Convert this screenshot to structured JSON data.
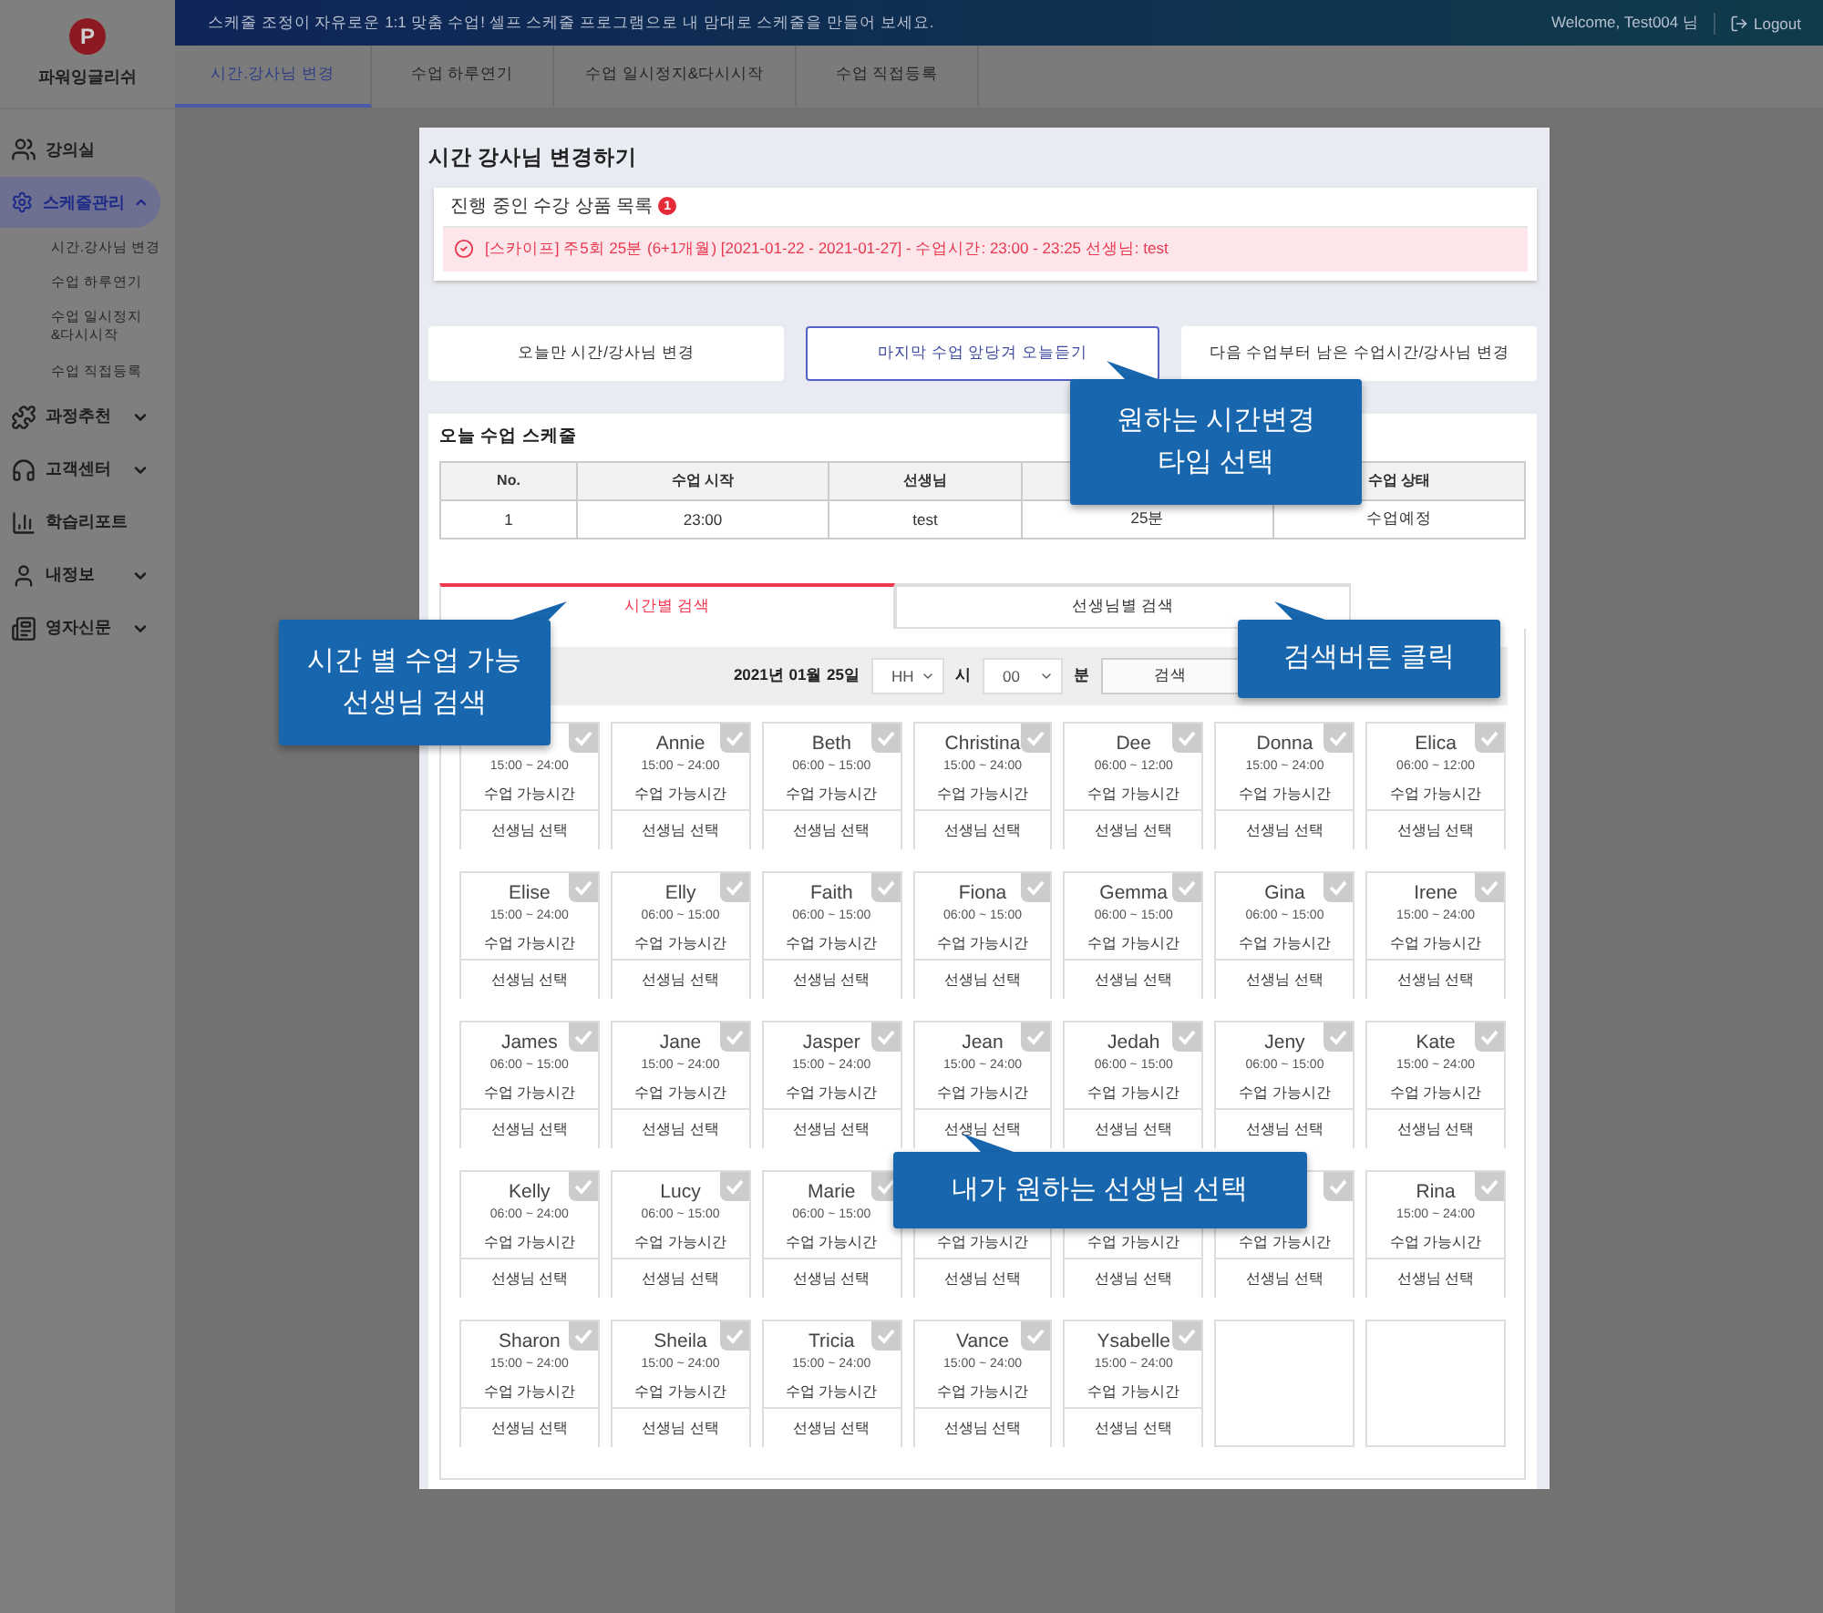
{
  "sidebar": {
    "logo": "P",
    "brand": "파워잉글리쉬",
    "items": [
      {
        "label": "강의실",
        "selected": false
      },
      {
        "label": "스케줄관리",
        "selected": true,
        "expanded": true,
        "children": [
          {
            "lines": [
              "시간.강사님 변경"
            ]
          },
          {
            "lines": [
              "수업 하루연기"
            ]
          },
          {
            "lines": [
              "수업 일시정지",
              "&다시시작"
            ]
          },
          {
            "lines": [
              "수업 직접등록"
            ]
          }
        ]
      },
      {
        "label": "과정추천",
        "selected": false,
        "expanded": false
      },
      {
        "label": "고객센터",
        "selected": false,
        "expanded": false
      },
      {
        "label": "학습리포트",
        "selected": false
      },
      {
        "label": "내정보",
        "selected": false,
        "expanded": false
      },
      {
        "label": "영자신문",
        "selected": false,
        "expanded": false
      }
    ]
  },
  "top_bar": {
    "notice": "스케줄 조정이 자유로운 1:1 맞춤 수업! 셀프 스케줄 프로그램으로 내 맘대로 스케줄을 만들어 보세요.",
    "welcome": "Welcome, Test004 님",
    "logout": "Logout"
  },
  "tabs": [
    {
      "label": "시간.강사님 변경",
      "selected": true
    },
    {
      "label": "수업 하루연기",
      "selected": false
    },
    {
      "label": "수업 일시정지&다시시작",
      "selected": false
    },
    {
      "label": "수업 직접등록",
      "selected": false
    }
  ],
  "modal": {
    "title": "시간 강사님 변경하기",
    "products": {
      "title": "진행 중인 수강 상품 목록",
      "count": "1",
      "items": [
        {
          "text": "[스카이프] 주5회 25분 (6+1개월) [2021-01-22 - 2021-01-27] - 수업시간: 23:00 - 23:25 선생님: test"
        }
      ]
    },
    "options": [
      {
        "label": "오늘만 시간/강사님 변경",
        "selected": false
      },
      {
        "label": "마지막 수업 앞당겨 오늘듣기",
        "selected": true
      },
      {
        "label": "다음 수업부터 남은 수업시간/강사님 변경",
        "selected": false
      }
    ],
    "schedule": {
      "title": "오늘 수업 스케줄",
      "columns": [
        "No.",
        "수업 시작",
        "선생님",
        null,
        "수업 상태"
      ],
      "rows": [
        [
          "1",
          "23:00",
          "test",
          "25분",
          "수업예정"
        ]
      ]
    },
    "search_tabs": [
      {
        "label": "시간별 검색",
        "selected": true
      },
      {
        "label": "선생님별 검색",
        "selected": false
      }
    ],
    "filter": {
      "date": "2021년 01월 25일",
      "hour": "HH",
      "hour_unit": "시",
      "minute": "00",
      "minute_unit": "분",
      "button": "검색"
    },
    "cards": [
      {
        "kind": "teacher",
        "time": "15:00 ~ 24:00",
        "note": "수업 가능시간",
        "action": "선생님 선택"
      },
      {
        "kind": "teacher",
        "name": "Annie",
        "time": "15:00 ~ 24:00",
        "note": "수업 가능시간",
        "action": "선생님 선택"
      },
      {
        "kind": "teacher",
        "name": "Beth",
        "time": "06:00 ~ 15:00",
        "note": "수업 가능시간",
        "action": "선생님 선택"
      },
      {
        "kind": "teacher",
        "name": "Christina",
        "time": "15:00 ~ 24:00",
        "note": "수업 가능시간",
        "action": "선생님 선택"
      },
      {
        "kind": "teacher",
        "name": "Dee",
        "time": "06:00 ~ 12:00",
        "note": "수업 가능시간",
        "action": "선생님 선택"
      },
      {
        "kind": "teacher",
        "name": "Donna",
        "time": "15:00 ~ 24:00",
        "note": "수업 가능시간",
        "action": "선생님 선택"
      },
      {
        "kind": "teacher",
        "name": "Elica",
        "time": "06:00 ~ 12:00",
        "note": "수업 가능시간",
        "action": "선생님 선택"
      },
      {
        "kind": "teacher",
        "name": "Elise",
        "time": "15:00 ~ 24:00",
        "note": "수업 가능시간",
        "action": "선생님 선택"
      },
      {
        "kind": "teacher",
        "name": "Elly",
        "time": "06:00 ~ 15:00",
        "note": "수업 가능시간",
        "action": "선생님 선택"
      },
      {
        "kind": "teacher",
        "name": "Faith",
        "time": "06:00 ~ 15:00",
        "note": "수업 가능시간",
        "action": "선생님 선택"
      },
      {
        "kind": "teacher",
        "name": "Fiona",
        "time": "06:00 ~ 15:00",
        "note": "수업 가능시간",
        "action": "선생님 선택"
      },
      {
        "kind": "teacher",
        "name": "Gemma",
        "time": "06:00 ~ 15:00",
        "note": "수업 가능시간",
        "action": "선생님 선택"
      },
      {
        "kind": "teacher",
        "name": "Gina",
        "time": "06:00 ~ 15:00",
        "note": "수업 가능시간",
        "action": "선생님 선택"
      },
      {
        "kind": "teacher",
        "name": "Irene",
        "time": "15:00 ~ 24:00",
        "note": "수업 가능시간",
        "action": "선생님 선택"
      },
      {
        "kind": "teacher",
        "name": "James",
        "time": "06:00 ~ 15:00",
        "note": "수업 가능시간",
        "action": "선생님 선택"
      },
      {
        "kind": "teacher",
        "name": "Jane",
        "time": "15:00 ~ 24:00",
        "note": "수업 가능시간",
        "action": "선생님 선택"
      },
      {
        "kind": "teacher",
        "name": "Jasper",
        "time": "15:00 ~ 24:00",
        "note": "수업 가능시간",
        "action": "선생님 선택"
      },
      {
        "kind": "teacher",
        "name": "Jean",
        "time": "15:00 ~ 24:00",
        "note": "수업 가능시간",
        "action": "선생님 선택"
      },
      {
        "kind": "teacher",
        "name": "Jedah",
        "time": "06:00 ~ 15:00",
        "note": "수업 가능시간",
        "action": "선생님 선택"
      },
      {
        "kind": "teacher",
        "name": "Jeny",
        "time": "06:00 ~ 15:00",
        "note": "수업 가능시간",
        "action": "선생님 선택"
      },
      {
        "kind": "teacher",
        "name": "Kate",
        "time": "15:00 ~ 24:00",
        "note": "수업 가능시간",
        "action": "선생님 선택"
      },
      {
        "kind": "teacher",
        "name": "Kelly",
        "time": "06:00 ~ 24:00",
        "note": "수업 가능시간",
        "action": "선생님 선택"
      },
      {
        "kind": "teacher",
        "name": "Lucy",
        "time": "06:00 ~ 15:00",
        "note": "수업 가능시간",
        "action": "선생님 선택"
      },
      {
        "kind": "teacher",
        "name": "Marie",
        "time": "06:00 ~ 15:00",
        "note": "수업 가능시간",
        "action": "선생님 선택"
      },
      {
        "kind": "teacher",
        "corner_check": false,
        "note": "수업 가능시간",
        "action": "선생님 선택"
      },
      {
        "kind": "teacher",
        "corner_check": false,
        "note": "수업 가능시간",
        "action": "선생님 선택"
      },
      {
        "kind": "teacher",
        "note": "수업 가능시간",
        "action": "선생님 선택"
      },
      {
        "kind": "teacher",
        "name": "Rina",
        "time": "15:00 ~ 24:00",
        "note": "수업 가능시간",
        "action": "선생님 선택"
      },
      {
        "kind": "teacher",
        "name": "Sharon",
        "time": "15:00 ~ 24:00",
        "note": "수업 가능시간",
        "action": "선생님 선택"
      },
      {
        "kind": "teacher",
        "name": "Sheila",
        "time": "15:00 ~ 24:00",
        "note": "수업 가능시간",
        "action": "선생님 선택"
      },
      {
        "kind": "teacher",
        "name": "Tricia",
        "time": "15:00 ~ 24:00",
        "note": "수업 가능시간",
        "action": "선생님 선택"
      },
      {
        "kind": "teacher",
        "name": "Vance",
        "time": "15:00 ~ 24:00",
        "note": "수업 가능시간",
        "action": "선생님 선택"
      },
      {
        "kind": "teacher",
        "name": "Ysabelle",
        "time": "15:00 ~ 24:00",
        "note": "수업 가능시간",
        "action": "선생님 선택"
      },
      {
        "kind": "empty"
      },
      {
        "kind": "empty"
      }
    ]
  },
  "callouts": [
    {
      "lines": [
        "원하는 시간변경",
        "타입 선택"
      ]
    },
    {
      "lines": [
        "시간 별 수업 가능",
        "선생님 검색"
      ]
    },
    {
      "lines": [
        "검색버튼 클릭"
      ]
    },
    {
      "lines": [
        "내가 원하는 선생님 선택"
      ]
    }
  ]
}
